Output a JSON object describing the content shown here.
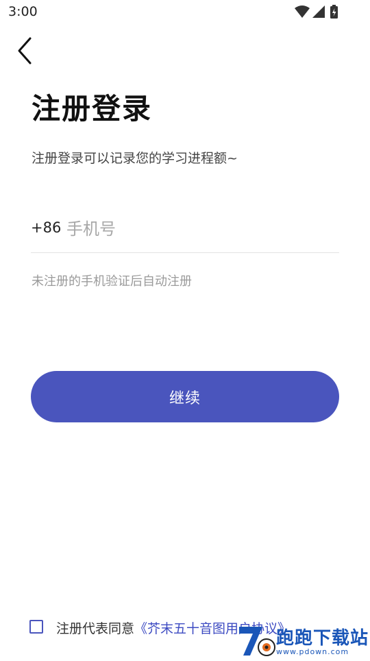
{
  "status_bar": {
    "time": "3:00",
    "icons": [
      "wifi-icon",
      "cell-signal-icon",
      "battery-charging-icon"
    ]
  },
  "header": {
    "back_icon": "chevron-left-icon"
  },
  "main": {
    "title": "注册登录",
    "subtitle": "注册登录可以记录您的学习进程额~",
    "phone": {
      "country_code": "+86",
      "placeholder": "手机号",
      "value": ""
    },
    "hint": "未注册的手机验证后自动注册",
    "continue_label": "继续"
  },
  "agreement": {
    "checked": false,
    "prefix": "注册代表同意",
    "link": "《芥末五十音图用户协议》"
  },
  "watermark": {
    "main": "跑跑下载站",
    "sub": "www.pdown.com"
  },
  "colors": {
    "accent": "#4a55bd",
    "link": "#3d4bc2",
    "hint": "#9a9a9a",
    "divider": "#e3e3e3"
  }
}
